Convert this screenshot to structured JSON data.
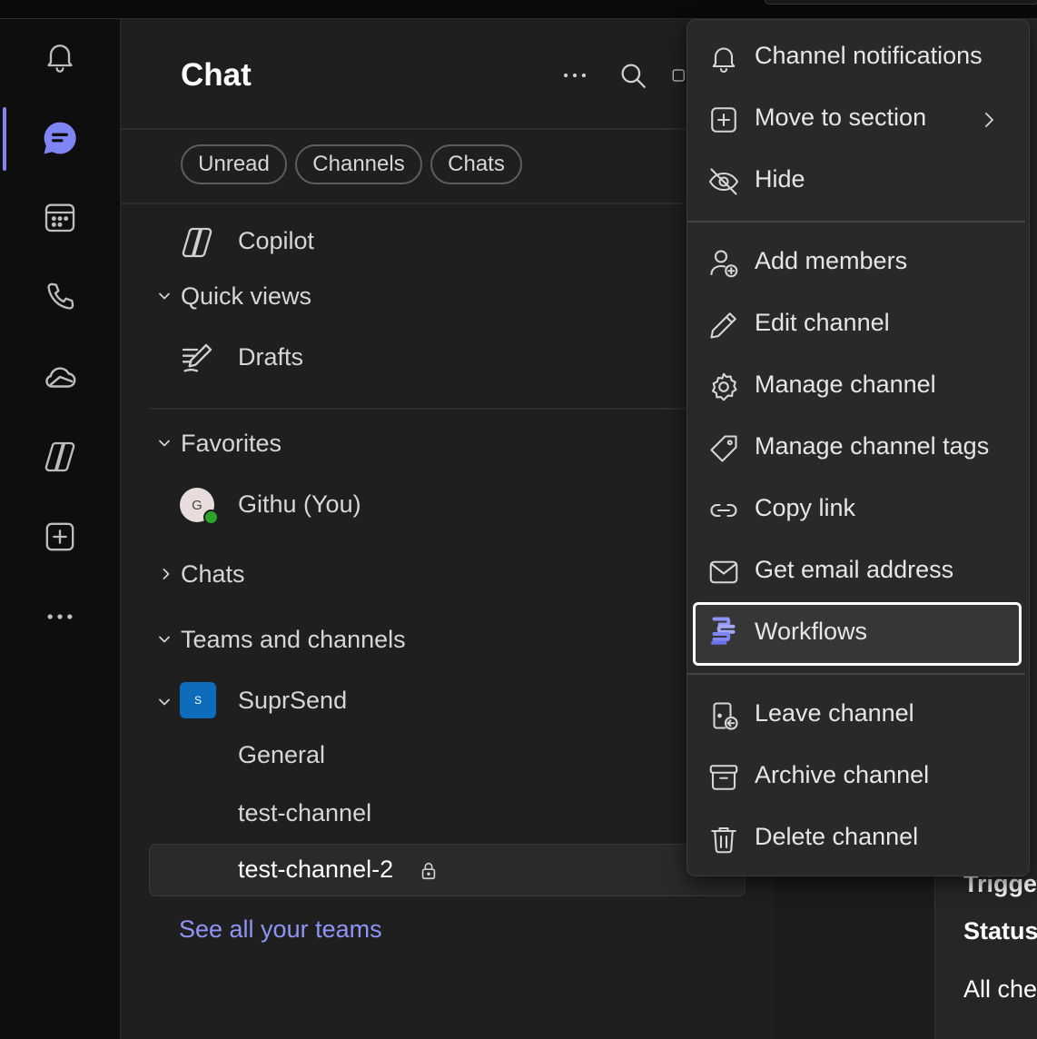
{
  "app": {
    "pane_title": "Chat",
    "accent": "#7f85f5",
    "link_color": "#8f95f7",
    "team_color": "#0f6cbd",
    "presence_color": "#2aa52a"
  },
  "rail": {
    "items": [
      {
        "name": "Activity",
        "icon": "bell-icon"
      },
      {
        "name": "Chat",
        "icon": "chat-icon",
        "active": true
      },
      {
        "name": "Calendar",
        "icon": "calendar-icon"
      },
      {
        "name": "Calls",
        "icon": "phone-icon"
      },
      {
        "name": "OneDrive",
        "icon": "cloud-icon"
      },
      {
        "name": "Copilot",
        "icon": "copilot-icon"
      },
      {
        "name": "Apps",
        "icon": "add-apps-icon"
      },
      {
        "name": "More",
        "icon": "more-icon"
      }
    ]
  },
  "filters": [
    "Unread",
    "Channels",
    "Chats"
  ],
  "list": {
    "copilot": "Copilot",
    "quick_views": "Quick views",
    "drafts": "Drafts",
    "favorites": "Favorites",
    "self_name": "Githu (You)",
    "self_initial": "G",
    "chats": "Chats",
    "teams_and_channels": "Teams and channels",
    "team_name": "SuprSend",
    "team_initial": "S",
    "channels": [
      "General",
      "test-channel",
      "test-channel-2"
    ],
    "see_all": "See all your teams"
  },
  "right_pane": {
    "fragments": [
      "Trigge",
      "Status",
      "All che"
    ]
  },
  "context_menu": {
    "items": [
      {
        "label": "Channel notifications",
        "icon": "bell-icon"
      },
      {
        "label": "Move to section",
        "icon": "square-plus-icon",
        "has_submenu": true
      },
      {
        "label": "Hide",
        "icon": "eye-off-icon"
      },
      {
        "label": "Add members",
        "icon": "person-add-icon"
      },
      {
        "label": "Edit channel",
        "icon": "pencil-icon"
      },
      {
        "label": "Manage channel",
        "icon": "gear-icon"
      },
      {
        "label": "Manage channel tags",
        "icon": "tag-icon"
      },
      {
        "label": "Copy link",
        "icon": "link-icon"
      },
      {
        "label": "Get email address",
        "icon": "mail-icon"
      },
      {
        "label": "Workflows",
        "icon": "workflows-icon",
        "focused": true
      },
      {
        "label": "Leave channel",
        "icon": "door-leave-icon"
      },
      {
        "label": "Archive channel",
        "icon": "archive-icon"
      },
      {
        "label": "Delete channel",
        "icon": "trash-icon"
      }
    ]
  }
}
